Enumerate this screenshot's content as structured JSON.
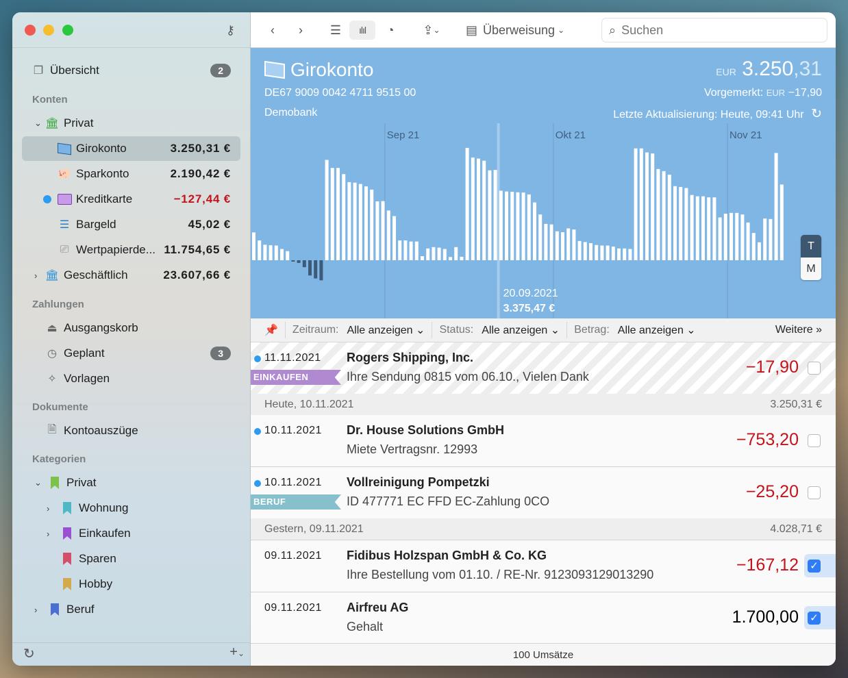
{
  "window": {
    "traffic_lights": {
      "close": "#ee5a52",
      "minimize": "#f6bd2f",
      "zoom": "#2bc73f"
    }
  },
  "sidebar": {
    "overview": {
      "label": "Übersicht",
      "badge": "2",
      "icon": "overview-icon"
    },
    "sections": {
      "accounts": "Konten",
      "payments": "Zahlungen",
      "documents": "Dokumente",
      "categories": "Kategorien"
    },
    "account_groups": [
      {
        "label": "Privat",
        "expanded": true,
        "icon": "bank-icon",
        "color": "#3aa53a"
      },
      {
        "label": "Geschäftlich",
        "expanded": false,
        "amount": "23.607,66 €",
        "icon": "bank-icon",
        "color": "#2a8fd8"
      }
    ],
    "accounts": [
      {
        "label": "Girokonto",
        "amount": "3.250,31 €",
        "icon": "checking-account-icon",
        "selected": true
      },
      {
        "label": "Sparkonto",
        "amount": "2.190,42 €",
        "icon": "piggy-bank-icon"
      },
      {
        "label": "Kreditkarte",
        "amount": "−127,44 €",
        "icon": "credit-card-icon",
        "negative": true,
        "unread": true
      },
      {
        "label": "Bargeld",
        "amount": "45,02 €",
        "icon": "cash-icon"
      },
      {
        "label": "Wertpapierde...",
        "amount": "11.754,65 €",
        "icon": "securities-icon"
      }
    ],
    "payments": [
      {
        "label": "Ausgangskorb",
        "icon": "outbox-icon"
      },
      {
        "label": "Geplant",
        "badge": "3",
        "icon": "clock-icon"
      },
      {
        "label": "Vorlagen",
        "icon": "templates-icon"
      }
    ],
    "documents": [
      {
        "label": "Kontoauszüge",
        "icon": "statements-icon"
      }
    ],
    "categories": [
      {
        "label": "Privat",
        "color": "#7cc24a",
        "expanded": true
      },
      {
        "label": "Wohnung",
        "color": "#4fb8c6"
      },
      {
        "label": "Einkaufen",
        "color": "#9b4fd1"
      },
      {
        "label": "Sparen",
        "color": "#d2506a"
      },
      {
        "label": "Hobby",
        "color": "#d2a94f"
      },
      {
        "label": "Beruf",
        "color": "#4a6fd0"
      }
    ]
  },
  "toolbar": {
    "transfer_label": "Überweisung",
    "search_placeholder": "Suchen",
    "active_view": "chart"
  },
  "account": {
    "name": "Girokonto",
    "iban": "DE67 9009 0042 4711 9515 00",
    "bank": "Demobank",
    "currency": "EUR",
    "balance_main": "3.250",
    "balance_decimals": ",31",
    "pending_label": "Vorgemerkt:",
    "pending_currency": "EUR",
    "pending_amount": "−17,90",
    "updated": "Letzte Aktualisierung: Heute, 09:41 Uhr",
    "header_color": "#80b6e4",
    "range_buttons": [
      "T",
      "M"
    ],
    "range_selected": "T"
  },
  "chart_data": {
    "type": "bar",
    "month_labels": [
      {
        "date": "2021-09-01",
        "label": "Sep 21"
      },
      {
        "date": "2021-10-01",
        "label": "Okt 21"
      },
      {
        "date": "2021-11-01",
        "label": "Nov 21"
      }
    ],
    "selected": {
      "date": "2021-09-20",
      "date_label": "20.09.2021",
      "value_label": "3.375,47 €"
    },
    "x": [
      "2021-08-08",
      "2021-08-09",
      "2021-08-10",
      "2021-08-11",
      "2021-08-12",
      "2021-08-13",
      "2021-08-14",
      "2021-08-15",
      "2021-08-16",
      "2021-08-17",
      "2021-08-18",
      "2021-08-19",
      "2021-08-20",
      "2021-08-21",
      "2021-08-22",
      "2021-08-23",
      "2021-08-24",
      "2021-08-25",
      "2021-08-26",
      "2021-08-27",
      "2021-08-28",
      "2021-08-29",
      "2021-08-30",
      "2021-08-31",
      "2021-09-01",
      "2021-09-02",
      "2021-09-03",
      "2021-09-04",
      "2021-09-05",
      "2021-09-06",
      "2021-09-07",
      "2021-09-08",
      "2021-09-09",
      "2021-09-10",
      "2021-09-11",
      "2021-09-12",
      "2021-09-13",
      "2021-09-14",
      "2021-09-15",
      "2021-09-16",
      "2021-09-17",
      "2021-09-18",
      "2021-09-19",
      "2021-09-20",
      "2021-09-21",
      "2021-09-22",
      "2021-09-23",
      "2021-09-24",
      "2021-09-25",
      "2021-09-26",
      "2021-09-27",
      "2021-09-28",
      "2021-09-29",
      "2021-09-30",
      "2021-10-01",
      "2021-10-02",
      "2021-10-03",
      "2021-10-04",
      "2021-10-05",
      "2021-10-06",
      "2021-10-07",
      "2021-10-08",
      "2021-10-09",
      "2021-10-10",
      "2021-10-11",
      "2021-10-12",
      "2021-10-13",
      "2021-10-14",
      "2021-10-15",
      "2021-10-16",
      "2021-10-17",
      "2021-10-18",
      "2021-10-19",
      "2021-10-20",
      "2021-10-21",
      "2021-10-22",
      "2021-10-23",
      "2021-10-24",
      "2021-10-25",
      "2021-10-26",
      "2021-10-27",
      "2021-10-28",
      "2021-10-29",
      "2021-10-30",
      "2021-10-31",
      "2021-11-01",
      "2021-11-02",
      "2021-11-03",
      "2021-11-04",
      "2021-11-05",
      "2021-11-06",
      "2021-11-07",
      "2021-11-08",
      "2021-11-09",
      "2021-11-10"
    ],
    "values": [
      1040,
      740,
      580,
      560,
      550,
      420,
      340,
      -50,
      -100,
      -260,
      -570,
      -680,
      -750,
      3750,
      3450,
      3450,
      3220,
      2920,
      2900,
      2850,
      2760,
      2640,
      2200,
      2210,
      1860,
      1650,
      740,
      740,
      700,
      700,
      150,
      440,
      490,
      470,
      420,
      120,
      490,
      130,
      4200,
      3840,
      3800,
      3720,
      3360,
      3375.47,
      2600,
      2570,
      2560,
      2540,
      2530,
      2460,
      2160,
      1710,
      1360,
      1340,
      1080,
      1050,
      1190,
      1150,
      720,
      680,
      640,
      570,
      550,
      550,
      510,
      440,
      440,
      420,
      4180,
      4180,
      4030,
      3990,
      3410,
      3330,
      3200,
      2770,
      2740,
      2700,
      2440,
      2390,
      2390,
      2350,
      2350,
      1600,
      1740,
      1770,
      1770,
      1710,
      1410,
      1020,
      670,
      1560,
      1540,
      4010,
      2830
    ],
    "positive_color": "#ffffff",
    "negative_color": "#3d5a78",
    "grid": "month lines"
  },
  "filter": {
    "period_label": "Zeitraum:",
    "period_value": "Alle anzeigen",
    "status_label": "Status:",
    "status_value": "Alle anzeigen",
    "amount_label": "Betrag:",
    "amount_value": "Alle anzeigen",
    "more_label": "Weitere"
  },
  "groups": [
    {
      "label": "Heute, 10.11.2021",
      "balance": "3.250,31 €"
    },
    {
      "label": "Gestern, 09.11.2021",
      "balance": "4.028,71 €"
    }
  ],
  "transactions": [
    {
      "date": "11.11.2021",
      "payee": "Rogers Shipping, Inc.",
      "purpose": "Ihre Sendung 0815 vom 06.10., Vielen Dank",
      "amount": "−17,90",
      "tag": "EINKAUFEN",
      "tag_color": "#b08ad0",
      "unread": true,
      "pending": true,
      "checked": false
    },
    {
      "date": "10.11.2021",
      "payee": "Dr. House Solutions GmbH",
      "purpose": "Miete Vertragsnr. 12993",
      "amount": "−753,20",
      "unread": true,
      "checked": false
    },
    {
      "date": "10.11.2021",
      "payee": "Vollreinigung Pompetzki",
      "purpose": "ID 477771 EC FFD EC-Zahlung 0CO",
      "amount": "−25,20",
      "tag": "BERUF",
      "tag_color": "#86c0cc",
      "unread": true,
      "checked": false
    },
    {
      "date": "09.11.2021",
      "payee": "Fidibus Holzspan GmbH & Co. KG",
      "purpose": "Ihre Bestellung vom 01.10. / RE-Nr. 9123093129013290",
      "amount": "−167,12",
      "checked": true
    },
    {
      "date": "09.11.2021",
      "payee": "Airfreu AG",
      "purpose": "Gehalt",
      "amount": "1.700,00",
      "checked": true
    }
  ],
  "footer": {
    "count": "100 Umsätze"
  }
}
